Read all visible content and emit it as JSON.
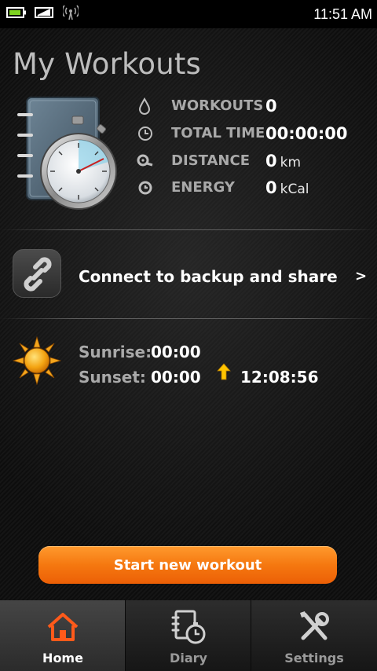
{
  "status_bar": {
    "time": "11:51 AM",
    "icons": [
      "battery-icon",
      "no-signal-icon",
      "wifi-icon"
    ]
  },
  "page": {
    "title": "My Workouts"
  },
  "stats": {
    "workouts": {
      "label": "WORKOUTS",
      "value": "0",
      "unit": "",
      "icon": "drop-icon"
    },
    "total_time": {
      "label": "TOTAL TIME",
      "value": "00:00:00",
      "unit": "",
      "icon": "clock-icon"
    },
    "distance": {
      "label": "DISTANCE",
      "value": "0",
      "unit": "km",
      "icon": "distance-icon"
    },
    "energy": {
      "label": "ENERGY",
      "value": "0",
      "unit": "kCal",
      "icon": "energy-icon"
    }
  },
  "connect": {
    "label": "Connect to backup and share",
    "chevron": ">"
  },
  "sun": {
    "sunrise_label": "Sunrise:",
    "sunrise_value": "00:00",
    "sunset_label": "Sunset:",
    "sunset_value": "00:00",
    "daylight": "12:08:56"
  },
  "actions": {
    "start_label": "Start new workout"
  },
  "tabs": [
    {
      "label": "Home",
      "icon": "home-icon",
      "active": true
    },
    {
      "label": "Diary",
      "icon": "diary-icon",
      "active": false
    },
    {
      "label": "Settings",
      "icon": "settings-icon",
      "active": false
    }
  ],
  "colors": {
    "accent": "#f57810",
    "home_icon": "#ff5a1a",
    "label_gray": "#a9a9a9",
    "sun_arrow": "#ffc400"
  }
}
